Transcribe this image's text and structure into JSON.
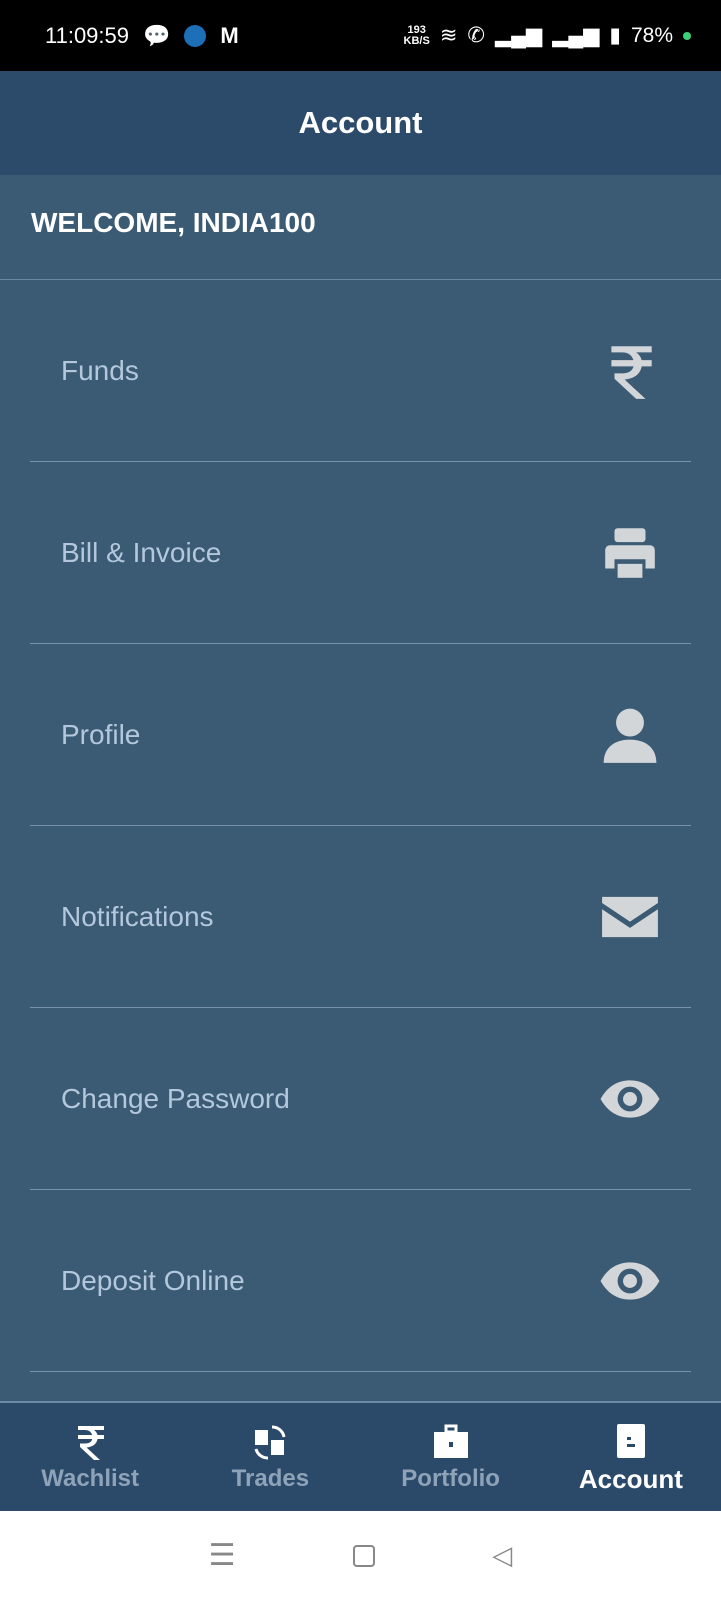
{
  "status_bar": {
    "time": "11:09:59",
    "speed_value": "193",
    "speed_unit": "KB/S",
    "battery": "78%"
  },
  "header": {
    "title": "Account"
  },
  "welcome": "WELCOME, INDIA100",
  "menu": [
    {
      "label": "Funds",
      "icon": "rupee-icon"
    },
    {
      "label": "Bill & Invoice",
      "icon": "printer-icon"
    },
    {
      "label": "Profile",
      "icon": "user-icon"
    },
    {
      "label": "Notifications",
      "icon": "envelope-icon"
    },
    {
      "label": "Change Password",
      "icon": "eye-icon"
    },
    {
      "label": "Deposit Online",
      "icon": "eye-icon"
    }
  ],
  "bottom_nav": [
    {
      "label": "Wachlist",
      "icon": "rupee-icon"
    },
    {
      "label": "Trades",
      "icon": "exchange-icon"
    },
    {
      "label": "Portfolio",
      "icon": "briefcase-icon"
    },
    {
      "label": "Account",
      "icon": "account-icon",
      "active": true
    }
  ],
  "colors": {
    "header": "#2c4b6b",
    "background": "#3b5a74",
    "menu_text": "#b3c8dd",
    "icon": "#d3d6d9"
  }
}
